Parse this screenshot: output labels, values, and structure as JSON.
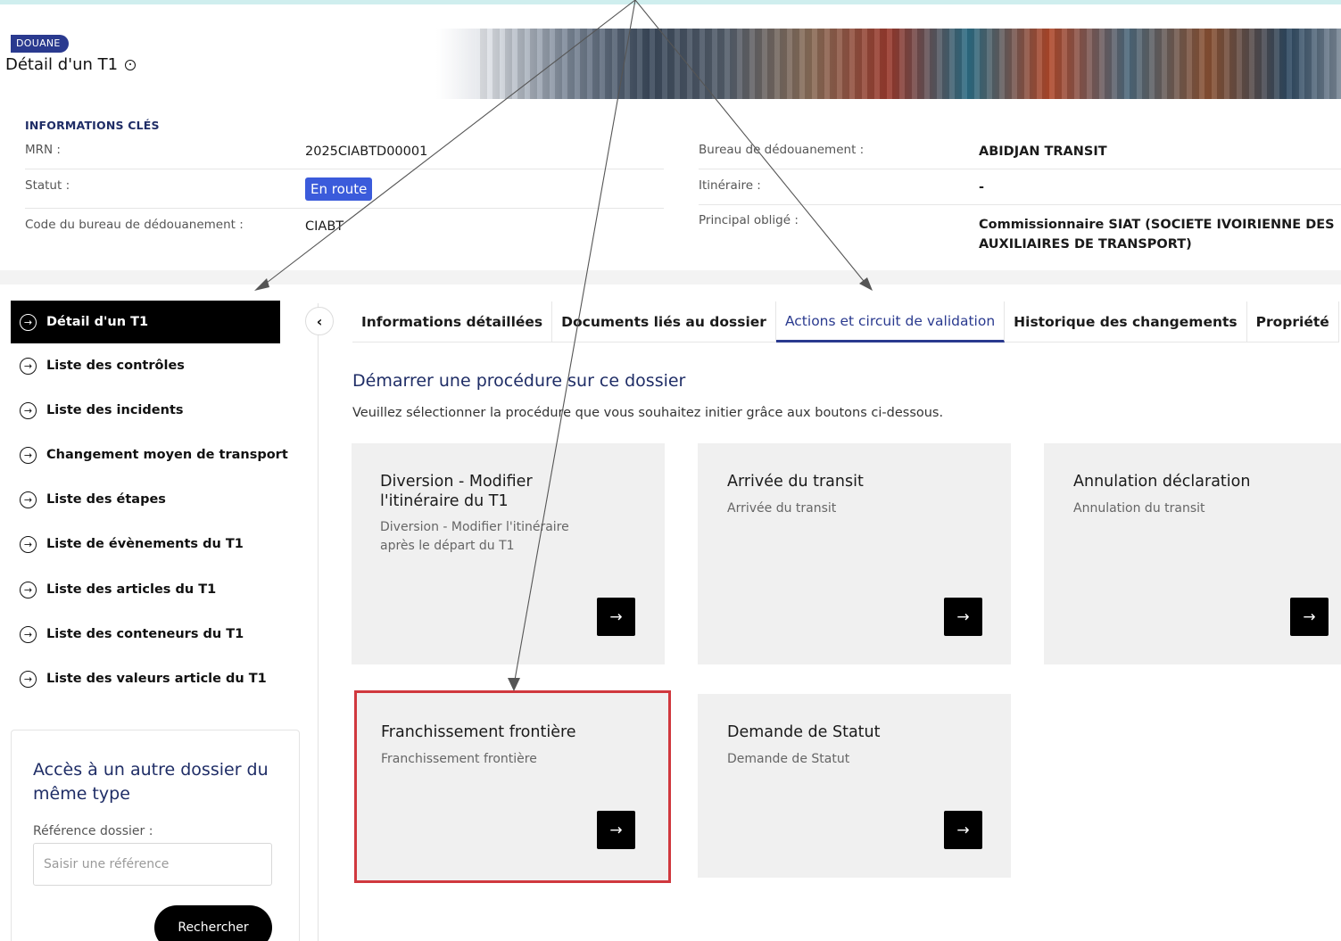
{
  "header": {
    "badge": "DOUANE",
    "title": "Détail d'un T1"
  },
  "key_info": {
    "heading": "INFORMATIONS CLÉS",
    "mrn_label": "MRN :",
    "mrn_value": "2025CIABTD00001",
    "statut_label": "Statut :",
    "statut_value": "En route",
    "code_bureau_label": "Code du bureau de dédouanement :",
    "code_bureau_value": "CIABT",
    "bureau_label": "Bureau de dédouanement :",
    "bureau_value": "ABIDJAN TRANSIT",
    "itineraire_label": "Itinéraire :",
    "itineraire_value": "-",
    "principal_label": "Principal obligé :",
    "principal_value_line1": "Commissionnaire SIAT (SOCIETE IVOIRIENNE DES",
    "principal_value_line2": "AUXILIAIRES DE TRANSPORT)"
  },
  "sidebar": {
    "items": [
      {
        "label": "Détail d'un T1"
      },
      {
        "label": "Liste des contrôles"
      },
      {
        "label": "Liste des incidents"
      },
      {
        "label": "Changement moyen de transport"
      },
      {
        "label": "Liste des étapes"
      },
      {
        "label": "Liste de évènements du T1"
      },
      {
        "label": "Liste des articles du T1"
      },
      {
        "label": "Liste des conteneurs du T1"
      },
      {
        "label": "Liste des valeurs article du T1"
      }
    ],
    "search": {
      "title": "Accès à un autre dossier du même type",
      "ref_label": "Référence dossier :",
      "placeholder": "Saisir une référence",
      "button": "Rechercher"
    }
  },
  "tabs": [
    {
      "label": "Informations détaillées"
    },
    {
      "label": "Documents liés au dossier"
    },
    {
      "label": "Actions et circuit de validation"
    },
    {
      "label": "Historique des changements"
    },
    {
      "label": "Propriété"
    }
  ],
  "section": {
    "title": "Démarrer une procédure sur ce dossier",
    "description": "Veuillez sélectionner la procédure que vous souhaitez initier grâce aux boutons ci-dessous."
  },
  "cards": [
    {
      "title": "Diversion - Modifier l'itinéraire du T1",
      "subtitle": "Diversion - Modifier l'itinéraire après le départ du T1",
      "button": "→"
    },
    {
      "title": "Arrivée du transit",
      "subtitle": "Arrivée du transit",
      "button": "→"
    },
    {
      "title": "Annulation déclaration",
      "subtitle": "Annulation du transit",
      "button": "→"
    },
    {
      "title": "Franchissement frontière",
      "subtitle": "Franchissement frontière",
      "button": "→"
    },
    {
      "title": "Demande de Statut",
      "subtitle": "Demande de Statut",
      "button": "→"
    }
  ],
  "icons": {
    "sidebar_item": "circle-arrow-right-icon",
    "collapse": "chevron-left-icon",
    "info": "info-icon",
    "card_button": "arrow-right-icon"
  },
  "colors": {
    "brand": "#2a3a8f",
    "status": "#3b5bdb",
    "highlight": "#d0383e",
    "active_sidebar": "#000000"
  }
}
